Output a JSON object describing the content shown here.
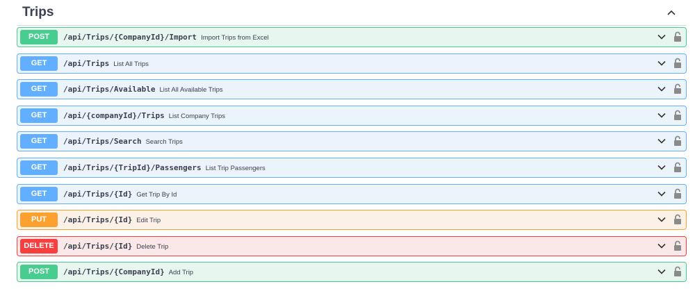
{
  "section": {
    "title": "Trips",
    "collapse_icon": "chevron-up-icon"
  },
  "operations": [
    {
      "method": "POST",
      "path": "/api/Trips/{CompanyId}/Import",
      "summary": "Import Trips from Excel"
    },
    {
      "method": "GET",
      "path": "/api/Trips",
      "summary": "List All Trips"
    },
    {
      "method": "GET",
      "path": "/api/Trips/Available",
      "summary": "List All Available Trips"
    },
    {
      "method": "GET",
      "path": "/api/{companyId}/Trips",
      "summary": "List Company Trips"
    },
    {
      "method": "GET",
      "path": "/api/Trips/Search",
      "summary": "Search Trips"
    },
    {
      "method": "GET",
      "path": "/api/Trips/{TripId}/Passengers",
      "summary": "List Trip Passengers"
    },
    {
      "method": "GET",
      "path": "/api/Trips/{Id}",
      "summary": "Get Trip By Id"
    },
    {
      "method": "PUT",
      "path": "/api/Trips/{Id}",
      "summary": "Edit Trip"
    },
    {
      "method": "DELETE",
      "path": "/api/Trips/{Id}",
      "summary": "Delete Trip"
    },
    {
      "method": "POST",
      "path": "/api/Trips/{CompanyId}",
      "summary": "Add Trip"
    }
  ],
  "colors": {
    "POST": "#49cc90",
    "GET": "#61affe",
    "PUT": "#fca130",
    "DELETE": "#f93e3e"
  }
}
